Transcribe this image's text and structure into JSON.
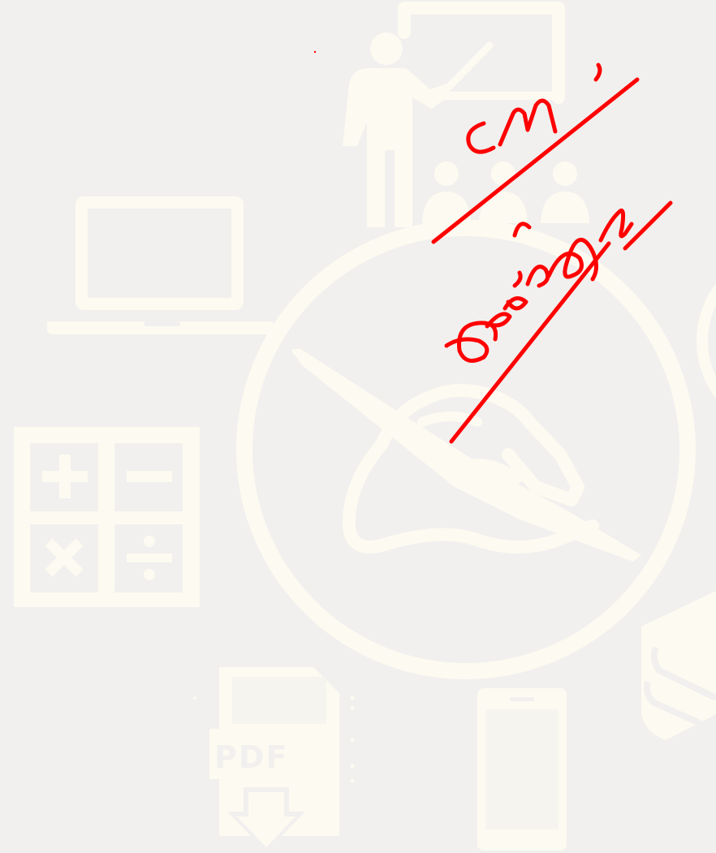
{
  "background_color": "#f1f0ee",
  "icon_color": "#fdfaf1",
  "ink_color": "#ff0000",
  "icons": {
    "teacher": "teacher-presenting-icon",
    "laptop": "laptop-icon",
    "calculator": "calculator-icon",
    "writing": "hand-writing-circle-icon",
    "pdf": "pdf-download-icon",
    "phone": "smartphone-icon",
    "books": "book-stack-icon",
    "partial_circle": "partial-circle-icon"
  },
  "pdf_label": "PDF",
  "handwriting": {
    "word_1": "cm,",
    "word_2": "Design"
  }
}
